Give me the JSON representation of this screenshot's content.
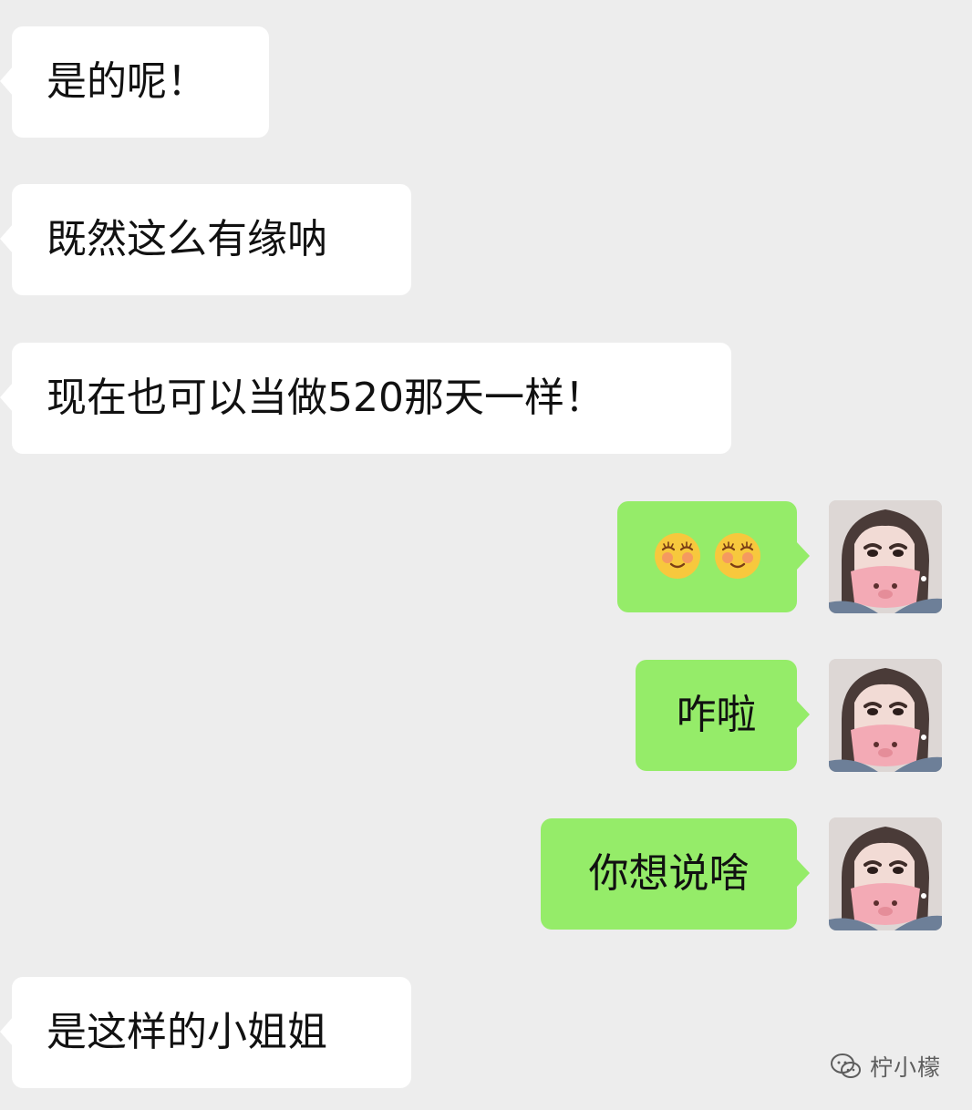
{
  "messages": [
    {
      "side": "left",
      "text": "是的呢！"
    },
    {
      "side": "left",
      "text": "既然这么有缘呐"
    },
    {
      "side": "left",
      "text": "现在也可以当做520那天一样！"
    },
    {
      "side": "right",
      "emoji": [
        "blushing-face",
        "blushing-face"
      ]
    },
    {
      "side": "right",
      "text": "咋啦"
    },
    {
      "side": "right",
      "text": "你想说啥"
    },
    {
      "side": "left",
      "text": "是这样的小姐姐"
    }
  ],
  "watermark": {
    "text": "柠小檬",
    "icon": "wechat-official-account-icon"
  },
  "colors": {
    "background": "#ededed",
    "incoming_bubble": "#ffffff",
    "outgoing_bubble": "#95ec69"
  }
}
